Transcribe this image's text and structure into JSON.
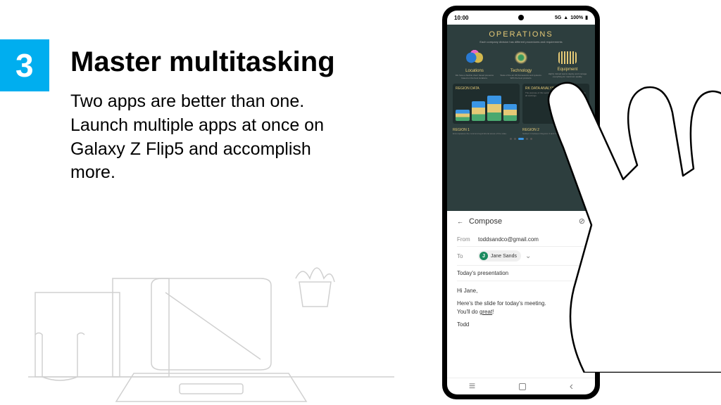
{
  "badge": {
    "number": "3"
  },
  "heading": "Master multitasking",
  "description": "Two apps are better than one. Launch multiple apps at once on Galaxy Z Flip5 and accomplish more.",
  "phone": {
    "status": {
      "time": "10:00",
      "network": "5G",
      "battery": "100%"
    },
    "operations": {
      "title": "OPERATIONS",
      "subtitle": "Each company division has different procedures and requirements",
      "cards": [
        {
          "label": "Locations",
          "text": "We have a flexible client based presence based on the best locations."
        },
        {
          "label": "Technology",
          "text": "State of the art 3D frameworks and systems. With the best products."
        },
        {
          "label": "Equipment",
          "text": "Highly trained teams deploy and manage everything for maximum quality."
        }
      ],
      "data_sections": [
        {
          "title": "REGION DATA"
        },
        {
          "title": "RK DATA ANALYSIS"
        }
      ],
      "regions": [
        {
          "title": "REGION 1",
          "text": "Encompasses the rural and agricultural areas of the state."
        },
        {
          "title": "REGION 2",
          "text": "Settled in between Regions 3 and 4 for growth."
        }
      ]
    },
    "compose": {
      "title": "Compose",
      "from_label": "From",
      "from_value": "toddsandco@gmail.com",
      "to_label": "To",
      "recipient_initial": "J",
      "recipient_name": "Jane Sands",
      "subject": "Today's presentation",
      "body_greeting": "Hi Jane,",
      "body_line1": "Here's the slide for today's meeting.",
      "body_line2_a": "You'll do ",
      "body_line2_b": "great",
      "body_line2_c": "!",
      "body_signoff": "Todd"
    }
  }
}
